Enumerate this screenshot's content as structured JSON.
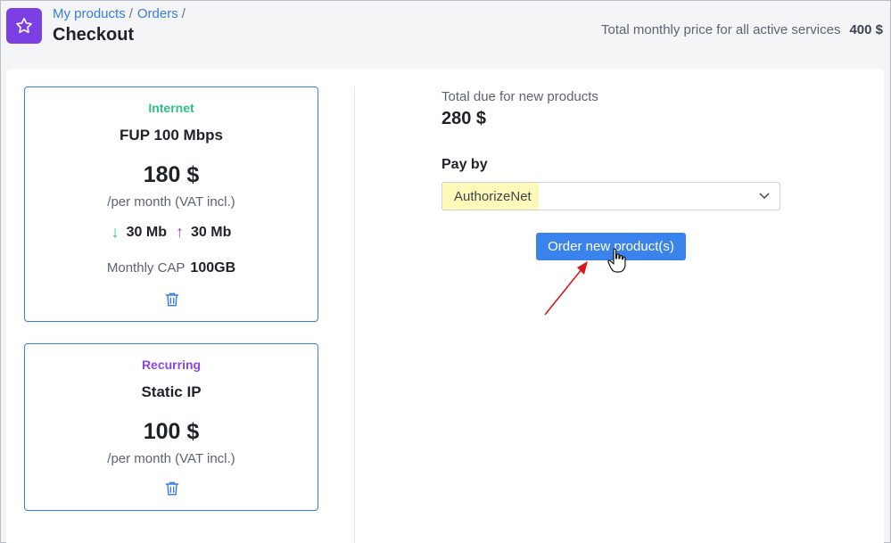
{
  "header": {
    "logo_icon": "star-icon",
    "accent_color": "#7b3fe4",
    "breadcrumb": [
      {
        "label": "My products"
      },
      {
        "label": "Orders"
      }
    ],
    "breadcrumb_separator": "/",
    "title": "Checkout",
    "total_monthly_label": "Total monthly price for all active services",
    "total_monthly_value": "400 $"
  },
  "cards": [
    {
      "category": "Internet",
      "category_color": "#2fbe85",
      "name": "FUP 100 Mbps",
      "price": "180 $",
      "period": "/per month (VAT incl.)",
      "download": "30 Mb",
      "upload": "30 Mb",
      "cap_label": "Monthly CAP",
      "cap_value": "100GB",
      "delete_icon": "trash-icon"
    },
    {
      "category": "Recurring",
      "category_color": "#8a46e8",
      "name": "Static IP",
      "price": "100 $",
      "period": "/per month (VAT incl.)",
      "delete_icon": "trash-icon"
    }
  ],
  "summary": {
    "due_label": "Total due for new products",
    "due_value": "280 $",
    "pay_by_label": "Pay by",
    "payment_method": "AuthorizeNet",
    "order_button": "Order new product(s)",
    "button_color": "#3a82ec"
  }
}
